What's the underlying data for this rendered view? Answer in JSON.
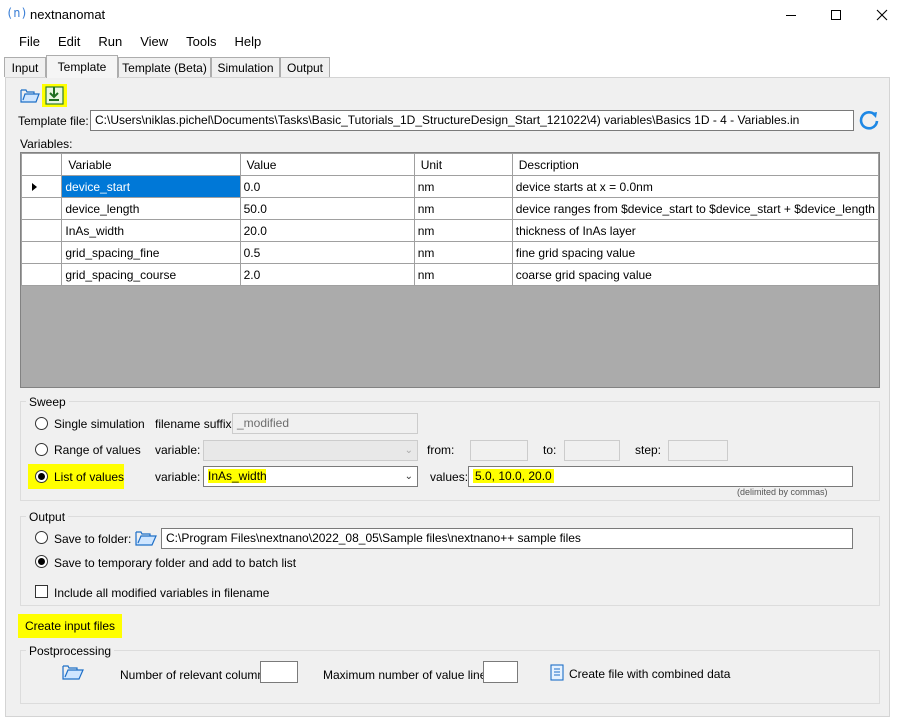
{
  "app": {
    "logo_text": "(n)",
    "title": "nextnanomat"
  },
  "menu": [
    "File",
    "Edit",
    "Run",
    "View",
    "Tools",
    "Help"
  ],
  "tabs": [
    "Input",
    "Template",
    "Template (Beta)",
    "Simulation",
    "Output"
  ],
  "template": {
    "file_label": "Template file:",
    "file_path": "C:\\Users\\niklas.pichel\\Documents\\Tasks\\Basic_Tutorials_1D_StructureDesign_Start_121022\\4) variables\\Basics 1D - 4 - Variables.in",
    "variables_label": "Variables:"
  },
  "grid": {
    "columns": [
      "Variable",
      "Value",
      "Unit",
      "Description"
    ],
    "rows": [
      {
        "variable": "device_start",
        "value": "0.0",
        "unit": "nm",
        "description": "device starts at x = 0.0nm"
      },
      {
        "variable": "device_length",
        "value": "50.0",
        "unit": "nm",
        "description": "device ranges from  $device_start to $device_start + $device_length"
      },
      {
        "variable": "InAs_width",
        "value": "20.0",
        "unit": "nm",
        "description": "thickness of InAs layer"
      },
      {
        "variable": "grid_spacing_fine",
        "value": "0.5",
        "unit": "nm",
        "description": "fine grid spacing value"
      },
      {
        "variable": "grid_spacing_course",
        "value": "2.0",
        "unit": "nm",
        "description": "coarse grid spacing value"
      }
    ]
  },
  "sweep": {
    "title": "Sweep",
    "single_label": "Single simulation",
    "suffix_label": "filename suffix:",
    "suffix_value": "_modified",
    "range_label": "Range of values",
    "variable_label": "variable:",
    "from_label": "from:",
    "to_label": "to:",
    "step_label": "step:",
    "list_label": "List of values",
    "list_variable": "InAs_width",
    "values_label": "values:",
    "values_value": "5.0, 10.0, 20.0",
    "delimiter_note": "(delimited by commas)"
  },
  "output": {
    "title": "Output",
    "save_folder_label": "Save to folder:",
    "folder_path": "C:\\Program Files\\nextnano\\2022_08_05\\Sample files\\nextnano++ sample files",
    "save_temp_label": "Save to temporary folder and add to batch list",
    "include_label": "Include all modified variables in filename"
  },
  "create_button": "Create input files",
  "postprocessing": {
    "title": "Postprocessing",
    "column_label": "Number of relevant column:",
    "max_lines_label": "Maximum number of value lines:",
    "combined_label": "Create file with combined data"
  },
  "colors": {
    "highlight": "#ffff00",
    "selection": "#0078d7",
    "accent": "#1e88e5"
  }
}
